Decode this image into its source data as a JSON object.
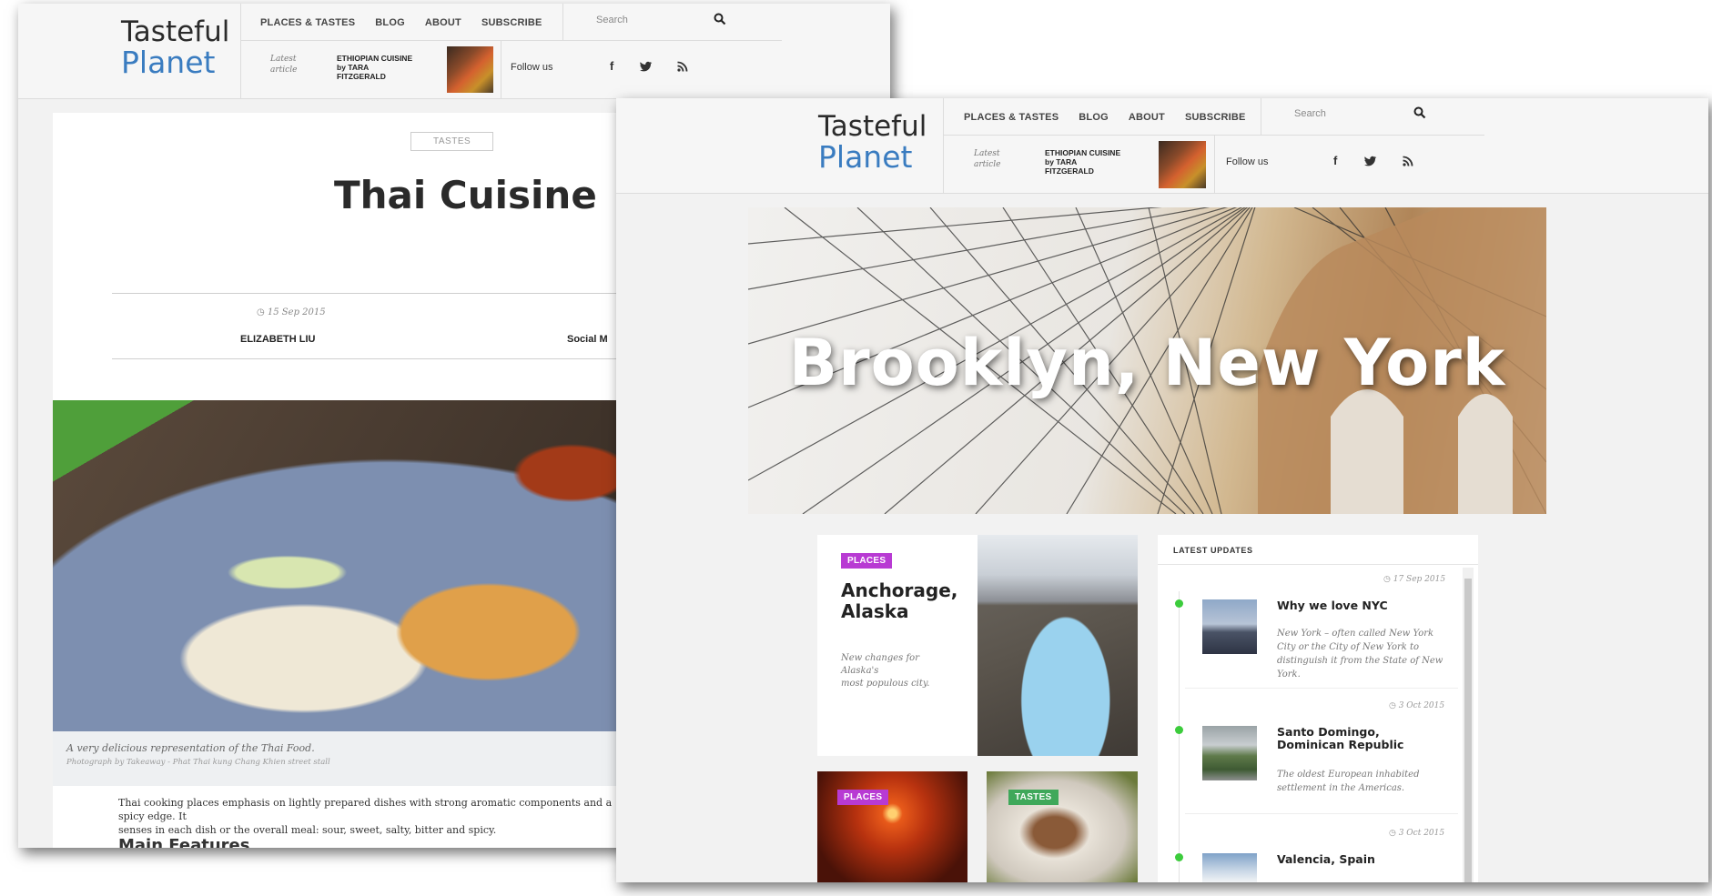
{
  "brand": {
    "line1": "Tasteful",
    "line2": "Planet",
    "accent": "#3a7cc0"
  },
  "nav": [
    "PLACES & TASTES",
    "BLOG",
    "ABOUT",
    "SUBSCRIBE"
  ],
  "search": {
    "placeholder": "Search"
  },
  "latest": {
    "label_line1": "Latest",
    "label_line2": "article",
    "title_line1": "ETHIOPIAN CUISINE",
    "title_line2": "by TARA",
    "title_line3": "FITZGERALD"
  },
  "follow": {
    "label": "Follow us",
    "facebook": "f",
    "twitter": "t",
    "rss": "rss"
  },
  "article": {
    "tag": "TASTES",
    "title": "Thai Cuisine",
    "date": "15 Sep 2015",
    "author": "ELIZABETH LIU",
    "social_label": "Social M",
    "caption": "A very delicious representation of the Thai Food.",
    "credit": "Photograph by Takeaway - Phat Thai kung Chang Khien street stall",
    "body_line1": "Thai cooking places emphasis on lightly prepared dishes with strong aromatic components and a spicy edge. It",
    "body_line2": "senses in each dish or the overall meal: sour, sweet, salty, bitter and spicy.",
    "subheading": "Main Features"
  },
  "hero": {
    "title": "Brooklyn, New York"
  },
  "cards": [
    {
      "badge": "PLACES",
      "title_line1": "Anchorage,",
      "title_line2": "Alaska",
      "subtitle_line1": "New changes for Alaska's",
      "subtitle_line2": "most populous city."
    },
    {
      "badge": "PLACES"
    },
    {
      "badge": "TASTES"
    }
  ],
  "updates": {
    "heading": "LATEST UPDATES",
    "items": [
      {
        "date": "17 Sep 2015",
        "title": "Why we love NYC",
        "desc": "New York – often called New York City or the City of New York to distinguish it from the State of New York."
      },
      {
        "date": "3 Oct 2015",
        "title": "Santo Domingo, Dominican Republic",
        "desc": "The oldest European inhabited settlement in the Americas."
      },
      {
        "date": "3 Oct 2015",
        "title": "Valencia, Spain",
        "desc": ""
      }
    ]
  },
  "colors": {
    "places_badge": "#b83ad3",
    "tastes_badge": "#3fa85a",
    "timeline_dot": "#3ccc3c"
  }
}
